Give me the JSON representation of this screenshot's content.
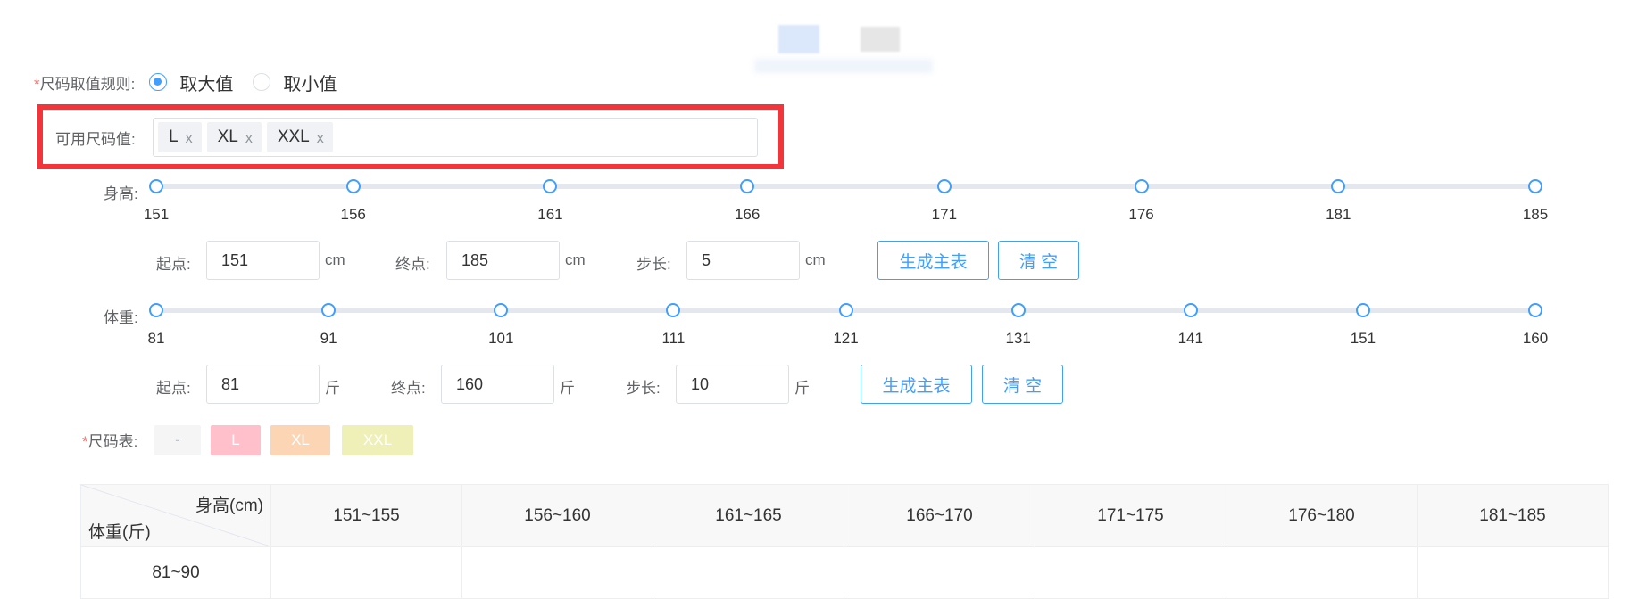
{
  "size_rule": {
    "required_mark": "*",
    "label": "尺码取值规则:",
    "options": [
      {
        "label": "取大值",
        "checked": true
      },
      {
        "label": "取小值",
        "checked": false
      }
    ]
  },
  "available_sizes": {
    "label": "可用尺码值:",
    "tags": [
      "L",
      "XL",
      "XXL"
    ],
    "close_glyph": "x"
  },
  "height_slider": {
    "label": "身高:",
    "ticks": [
      "151",
      "156",
      "161",
      "166",
      "171",
      "176",
      "181",
      "185"
    ],
    "start_label": "起点:",
    "start_value": "151",
    "end_label": "终点:",
    "end_value": "185",
    "step_label": "步长:",
    "step_value": "5",
    "unit": "cm",
    "generate_label": "生成主表",
    "clear_label": "清 空"
  },
  "weight_slider": {
    "label": "体重:",
    "ticks": [
      "81",
      "91",
      "101",
      "111",
      "121",
      "131",
      "141",
      "151",
      "160"
    ],
    "start_label": "起点:",
    "start_value": "81",
    "end_label": "终点:",
    "end_value": "160",
    "step_label": "步长:",
    "step_value": "10",
    "unit": "斤",
    "generate_label": "生成主表",
    "clear_label": "清 空"
  },
  "size_table": {
    "required_mark": "*",
    "label": "尺码表:",
    "chips": [
      {
        "label": "-",
        "color": "#f5f5f5",
        "text_color": "#c0c4cc"
      },
      {
        "label": "L",
        "color": "#ffc0cb",
        "text_color": "#ffffff"
      },
      {
        "label": "XL",
        "color": "#fcd5b5",
        "text_color": "#ffffff"
      },
      {
        "label": "XXL",
        "color": "#eef0b8",
        "text_color": "#ffffff"
      }
    ],
    "corner_top": "身高(cm)",
    "corner_bottom": "体重(斤)",
    "columns": [
      "151~155",
      "156~160",
      "161~165",
      "166~170",
      "171~175",
      "176~180",
      "181~185"
    ],
    "rows": [
      "81~90"
    ]
  },
  "colors": {
    "accent": "#409eff",
    "highlight": "#f2353a",
    "required": "#f56c6c"
  }
}
